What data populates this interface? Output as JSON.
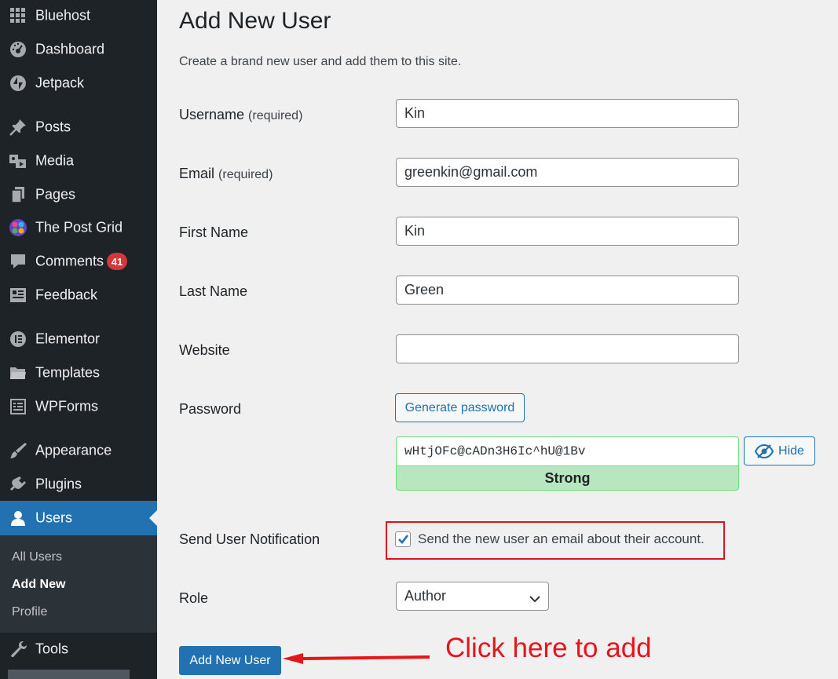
{
  "sidebar": {
    "items": [
      {
        "label": "Bluehost",
        "icon": "grid-icon"
      },
      {
        "label": "Dashboard",
        "icon": "dashboard-icon"
      },
      {
        "label": "Jetpack",
        "icon": "jetpack-icon"
      },
      {
        "label": "Posts",
        "icon": "pin-icon"
      },
      {
        "label": "Media",
        "icon": "media-icon"
      },
      {
        "label": "Pages",
        "icon": "pages-icon"
      },
      {
        "label": "The Post Grid",
        "icon": "post-grid-icon"
      },
      {
        "label": "Comments",
        "icon": "comment-icon",
        "badge": "41"
      },
      {
        "label": "Feedback",
        "icon": "feedback-icon"
      },
      {
        "label": "Elementor",
        "icon": "elementor-icon"
      },
      {
        "label": "Templates",
        "icon": "folder-icon"
      },
      {
        "label": "WPForms",
        "icon": "wpforms-icon"
      },
      {
        "label": "Appearance",
        "icon": "brush-icon"
      },
      {
        "label": "Plugins",
        "icon": "plugin-icon"
      },
      {
        "label": "Users",
        "icon": "user-icon",
        "active": true
      },
      {
        "label": "Tools",
        "icon": "wrench-icon"
      }
    ],
    "submenu": [
      {
        "label": "All Users"
      },
      {
        "label": "Add New",
        "current": true
      },
      {
        "label": "Profile"
      }
    ]
  },
  "page": {
    "title": "Add New User",
    "subtitle": "Create a brand new user and add them to this site."
  },
  "form": {
    "required_note": "(required)",
    "username": {
      "label": "Username",
      "value": "Kin"
    },
    "email": {
      "label": "Email",
      "value": "greenkin@gmail.com"
    },
    "first_name": {
      "label": "First Name",
      "value": "Kin"
    },
    "last_name": {
      "label": "Last Name",
      "value": "Green"
    },
    "website": {
      "label": "Website",
      "value": ""
    },
    "password": {
      "label": "Password",
      "generate_label": "Generate password",
      "value": "wHtjOFc@cADn3H6Ic^hU@1Bv",
      "hide_label": "Hide",
      "strength": "Strong"
    },
    "notification": {
      "label": "Send User Notification",
      "checkbox_label": "Send the new user an email about their account.",
      "checked": true
    },
    "role": {
      "label": "Role",
      "value": "Author"
    },
    "submit_label": "Add New User"
  },
  "annotation": {
    "text": "Click here to add",
    "color": "#e4161c"
  },
  "colors": {
    "sidebar_bg": "#1d2327",
    "accent": "#2271b1",
    "badge": "#d63638",
    "strength_bg": "#b8e6bf"
  }
}
